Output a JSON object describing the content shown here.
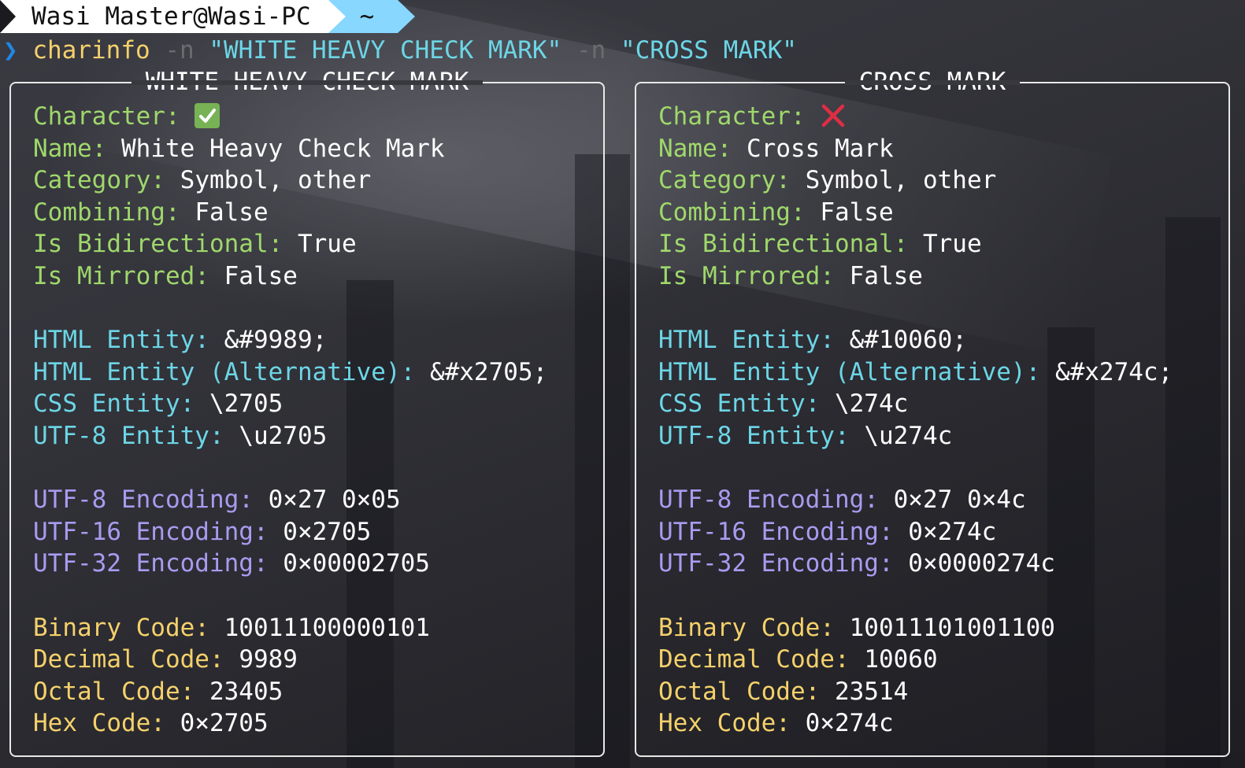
{
  "prompt": {
    "user_host": "Wasi Master@Wasi-PC",
    "directory": "~",
    "prompt_symbol": "❯",
    "command": "charinfo",
    "args": [
      {
        "flag": "-n",
        "value": "\"WHITE HEAVY CHECK MARK\""
      },
      {
        "flag": "-n",
        "value": "\"CROSS MARK\""
      }
    ]
  },
  "colors": {
    "general_label": "#9fd86b",
    "entity_label": "#6cd6e6",
    "encoding_label": "#a99bf0",
    "code_label": "#f5d16b",
    "value": "#ffffff",
    "check_green": "#77b255",
    "cross_red": "#dd2e44",
    "prompt_dir_bg": "#87d7ff"
  },
  "panels": [
    {
      "title": "WHITE HEAVY CHECK MARK",
      "character_icon": "white-heavy-check-mark-icon",
      "general": [
        {
          "label": "Character:",
          "value": ""
        },
        {
          "label": "Name:",
          "value": "White Heavy Check Mark"
        },
        {
          "label": "Category:",
          "value": "Symbol, other"
        },
        {
          "label": "Combining:",
          "value": "False"
        },
        {
          "label": "Is Bidirectional:",
          "value": "True"
        },
        {
          "label": "Is Mirrored:",
          "value": "False"
        }
      ],
      "entities": [
        {
          "label": "HTML Entity:",
          "value": "&#9989;"
        },
        {
          "label": "HTML Entity (Alternative):",
          "value": "&#x2705;"
        },
        {
          "label": "CSS Entity:",
          "value": "\\2705"
        },
        {
          "label": "UTF-8 Entity:",
          "value": "\\u2705"
        }
      ],
      "encodings": [
        {
          "label": "UTF-8 Encoding:",
          "value": "0×27 0×05"
        },
        {
          "label": "UTF-16 Encoding:",
          "value": "0×2705"
        },
        {
          "label": "UTF-32 Encoding:",
          "value": "0×00002705"
        }
      ],
      "codes": [
        {
          "label": "Binary Code:",
          "value": "10011100000101"
        },
        {
          "label": "Decimal Code:",
          "value": "9989"
        },
        {
          "label": "Octal Code:",
          "value": "23405"
        },
        {
          "label": "Hex Code:",
          "value": "0×2705"
        }
      ]
    },
    {
      "title": "CROSS MARK",
      "character_icon": "cross-mark-icon",
      "general": [
        {
          "label": "Character:",
          "value": ""
        },
        {
          "label": "Name:",
          "value": "Cross Mark"
        },
        {
          "label": "Category:",
          "value": "Symbol, other"
        },
        {
          "label": "Combining:",
          "value": "False"
        },
        {
          "label": "Is Bidirectional:",
          "value": "True"
        },
        {
          "label": "Is Mirrored:",
          "value": "False"
        }
      ],
      "entities": [
        {
          "label": "HTML Entity:",
          "value": "&#10060;"
        },
        {
          "label": "HTML Entity (Alternative):",
          "value": "&#x274c;"
        },
        {
          "label": "CSS Entity:",
          "value": "\\274c"
        },
        {
          "label": "UTF-8 Entity:",
          "value": "\\u274c"
        }
      ],
      "encodings": [
        {
          "label": "UTF-8 Encoding:",
          "value": "0×27 0×4c"
        },
        {
          "label": "UTF-16 Encoding:",
          "value": "0×274c"
        },
        {
          "label": "UTF-32 Encoding:",
          "value": "0×0000274c"
        }
      ],
      "codes": [
        {
          "label": "Binary Code:",
          "value": "10011101001100"
        },
        {
          "label": "Decimal Code:",
          "value": "10060"
        },
        {
          "label": "Octal Code:",
          "value": "23514"
        },
        {
          "label": "Hex Code:",
          "value": "0×274c"
        }
      ]
    }
  ]
}
